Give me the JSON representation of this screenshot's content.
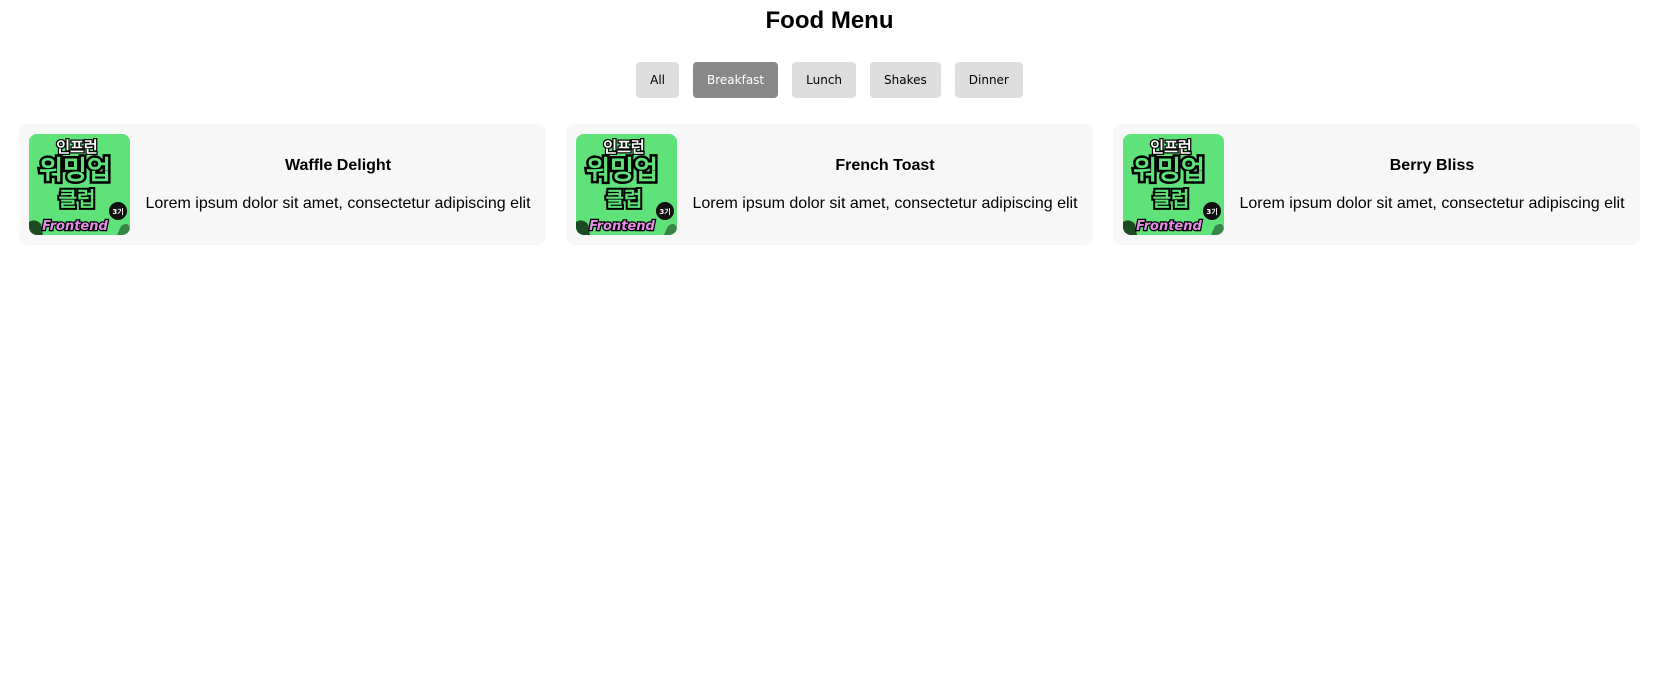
{
  "header": {
    "title": "Food Menu"
  },
  "filters": [
    {
      "label": "All",
      "active": false
    },
    {
      "label": "Breakfast",
      "active": true
    },
    {
      "label": "Lunch",
      "active": false
    },
    {
      "label": "Shakes",
      "active": false
    },
    {
      "label": "Dinner",
      "active": false
    }
  ],
  "items": [
    {
      "name": "Waffle Delight",
      "description": "Lorem ipsum dolor sit amet, consectetur adipiscing elit",
      "image": {
        "top": "인프런",
        "main": "워밍업",
        "sub": "클럽",
        "badge": "3기",
        "footer": "Frontend"
      }
    },
    {
      "name": "French Toast",
      "description": "Lorem ipsum dolor sit amet, consectetur adipiscing elit",
      "image": {
        "top": "인프런",
        "main": "워밍업",
        "sub": "클럽",
        "badge": "3기",
        "footer": "Frontend"
      }
    },
    {
      "name": "Berry Bliss",
      "description": "Lorem ipsum dolor sit amet, consectetur adipiscing elit",
      "image": {
        "top": "인프런",
        "main": "워밍업",
        "sub": "클럽",
        "badge": "3기",
        "footer": "Frontend"
      }
    }
  ],
  "colors": {
    "thumb_bg": "#5fe27a",
    "active_filter": "#888888",
    "inactive_filter": "#dddddd",
    "card_bg": "#f7f7f7"
  }
}
